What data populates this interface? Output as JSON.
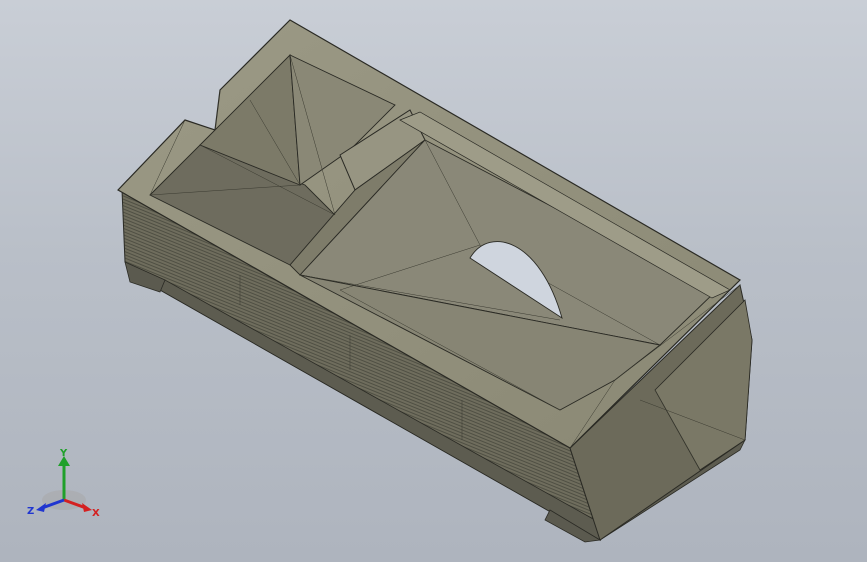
{
  "viewport": {
    "background_top": "#c9ced6",
    "background_bottom": "#aeb4be"
  },
  "model": {
    "face_color": "#8e8c78",
    "edge_color": "#2a2a24"
  },
  "triad": {
    "x_label": "X",
    "y_label": "Y",
    "z_label": "Z",
    "x_color": "#d42020",
    "y_color": "#1fa02a",
    "z_color": "#2036d0"
  }
}
